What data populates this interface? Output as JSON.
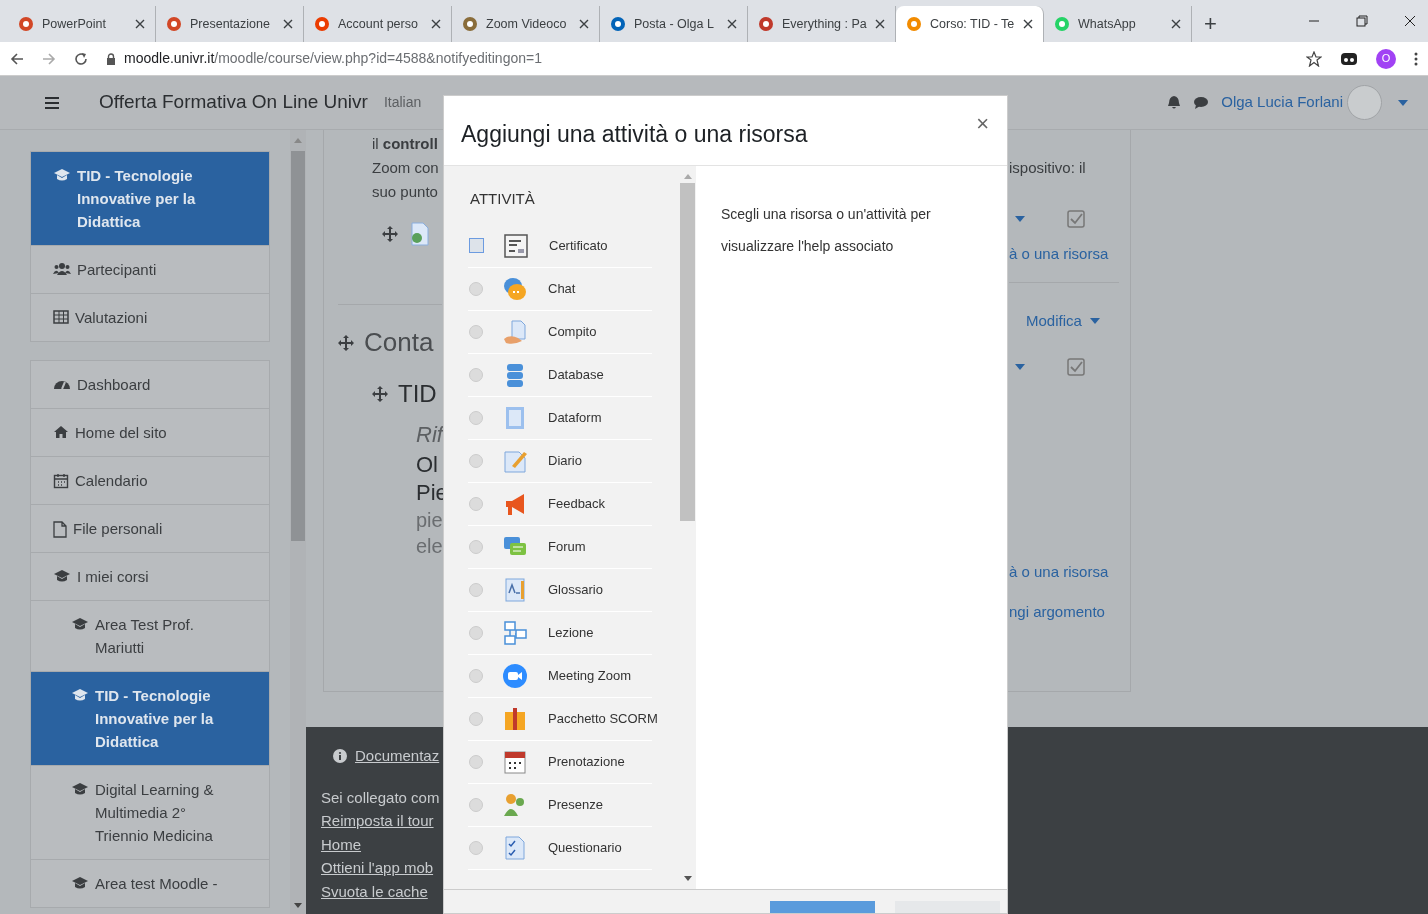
{
  "browser": {
    "tabs": [
      {
        "title": "PowerPoint",
        "selected": false
      },
      {
        "title": "Presentazione",
        "selected": false
      },
      {
        "title": "Account perso",
        "selected": false
      },
      {
        "title": "Zoom Videoco",
        "selected": false
      },
      {
        "title": "Posta - Olga L",
        "selected": false
      },
      {
        "title": "Everything : Pa",
        "selected": false
      },
      {
        "title": "Corso: TID - Te",
        "selected": true
      },
      {
        "title": "WhatsApp",
        "selected": false
      }
    ],
    "new_tab": "+",
    "url_host": "moodle.univr.it",
    "url_path": "/moodle/course/view.php?id=4588&notifyeditingon=1",
    "profile_initial": "O"
  },
  "header": {
    "site_name": "Offerta Formativa On Line Univr",
    "language": "Italian",
    "user_name": "Olga Lucia Forlani"
  },
  "sidebar": {
    "groups": [
      [
        {
          "label": "TID - Tecnologie Innovative per la Didattica",
          "selected": true
        },
        {
          "label": "Partecipanti",
          "selected": false
        },
        {
          "label": "Valutazioni",
          "selected": false
        }
      ],
      [
        {
          "label": "Dashboard",
          "selected": false
        },
        {
          "label": "Home del sito",
          "selected": false
        },
        {
          "label": "Calendario",
          "selected": false
        },
        {
          "label": "File personali",
          "selected": false
        },
        {
          "label": "I miei corsi",
          "selected": false,
          "children": [
            {
              "label": "Area Test Prof. Mariutti",
              "selected": false
            },
            {
              "label": "TID - Tecnologie Innovative per la Didattica",
              "selected": true
            },
            {
              "label": "Digital Learning & Multimedia 2° Triennio Medicina",
              "selected": false
            },
            {
              "label": "Area test Moodle -",
              "selected": false
            }
          ]
        }
      ]
    ]
  },
  "content": {
    "left": [
      {
        "kind": "text",
        "text": "il **controll**"
      },
      {
        "kind": "text",
        "text": "Zoom con"
      },
      {
        "kind": "text",
        "text": "suo punto"
      },
      {
        "kind": "activity"
      },
      {
        "kind": "section",
        "text": "Conta"
      },
      {
        "kind": "title",
        "text": "TID"
      },
      {
        "kind": "italic",
        "text": "Rif"
      },
      {
        "kind": "strong",
        "text": "Ol"
      },
      {
        "kind": "strong",
        "text": "Pie"
      },
      {
        "kind": "muted",
        "text": "pie"
      },
      {
        "kind": "muted",
        "text": "ele"
      }
    ],
    "right": [
      {
        "kind": "text",
        "text": "ispositivo: il"
      },
      {
        "kind": "controls"
      },
      {
        "kind": "link",
        "text": "à o una risorsa"
      },
      {
        "kind": "menu",
        "text": "Modifica"
      },
      {
        "kind": "controls"
      },
      {
        "kind": "link",
        "text": "à o una risorsa"
      },
      {
        "kind": "link",
        "text": "ngi argomento"
      }
    ]
  },
  "footer": [
    {
      "kind": "doc",
      "text": "Documentaz"
    },
    {
      "kind": "text",
      "text": "Sei collegato com"
    },
    {
      "kind": "link",
      "text": "Reimposta il tour"
    },
    {
      "kind": "link",
      "text": "Home"
    },
    {
      "kind": "link",
      "text": "Ottieni l'app mob"
    },
    {
      "kind": "link",
      "text": "Svuota le cache"
    }
  ],
  "dialog": {
    "title": "Aggiungi una attività o una risorsa",
    "close": "×",
    "section": "ATTIVITÀ",
    "items": [
      {
        "label": "Certificato",
        "selected": true
      },
      {
        "label": "Chat",
        "selected": false
      },
      {
        "label": "Compito",
        "selected": false
      },
      {
        "label": "Database",
        "selected": false
      },
      {
        "label": "Dataform",
        "selected": false
      },
      {
        "label": "Diario",
        "selected": false
      },
      {
        "label": "Feedback",
        "selected": false
      },
      {
        "label": "Forum",
        "selected": false
      },
      {
        "label": "Glossario",
        "selected": false
      },
      {
        "label": "Lezione",
        "selected": false
      },
      {
        "label": "Meeting Zoom",
        "selected": false
      },
      {
        "label": "Pacchetto SCORM",
        "selected": false
      },
      {
        "label": "Prenotazione",
        "selected": false
      },
      {
        "label": "Presenze",
        "selected": false
      },
      {
        "label": "Questionario",
        "selected": false
      }
    ],
    "help": "Scegli una risorsa o un'attività per visualizzare l'help associato"
  }
}
